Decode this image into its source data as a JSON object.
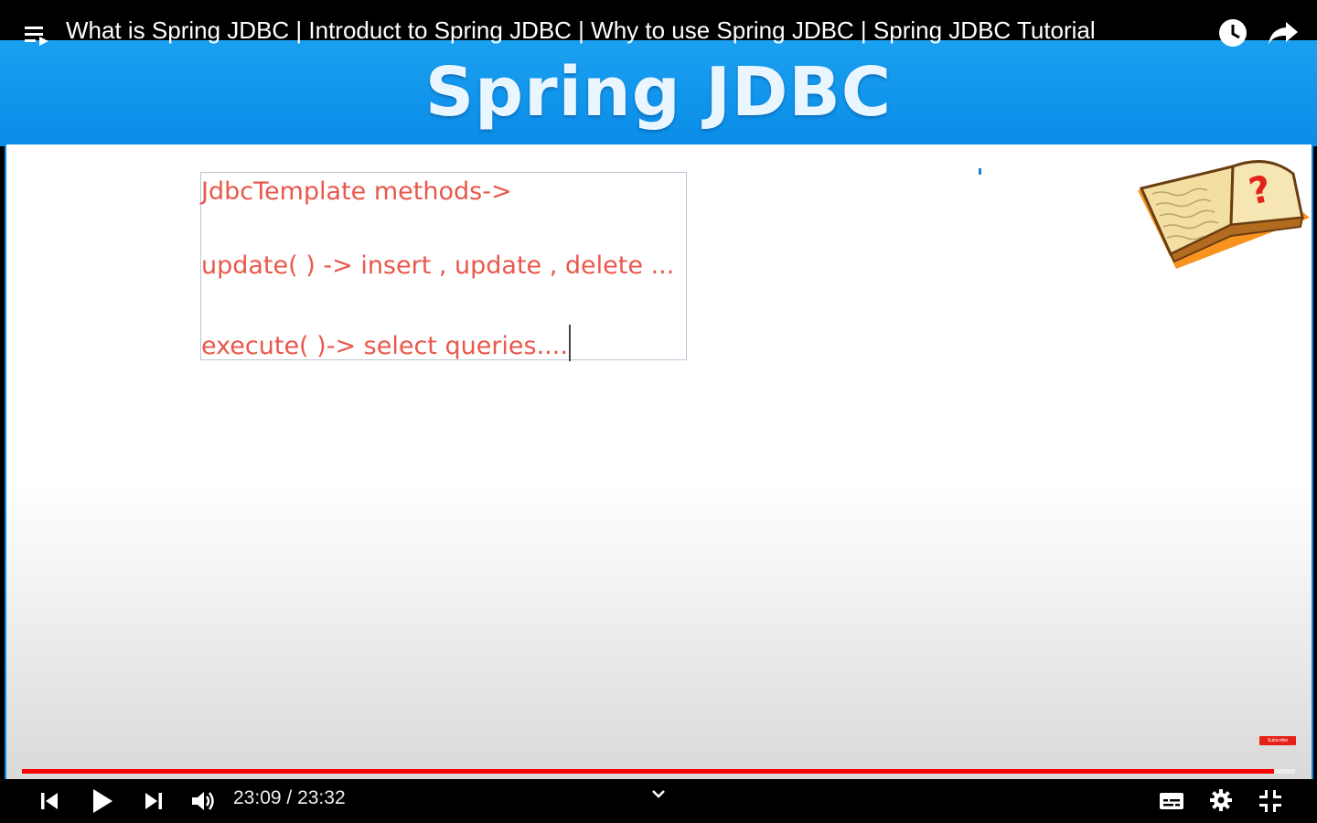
{
  "top_bar": {
    "title": "What is Spring JDBC | Introduct to Spring JDBC | Why to use Spring JDBC | Spring JDBC Tutorial"
  },
  "slide": {
    "heading": "Spring JDBC",
    "lines": [
      "JdbcTemplate methods->",
      "update(  ) -> insert , update , delete ...",
      "execute( )-> select queries...."
    ],
    "subscribe_label": "Subscribe"
  },
  "player": {
    "current_time": "23:09",
    "separator": " / ",
    "duration": "23:32",
    "progress_fraction": 0.9835
  },
  "icons": {
    "playlist": "playlist-icon",
    "watch_later": "clock-icon",
    "share": "share-icon",
    "previous": "previous-icon",
    "play": "play-icon",
    "next": "next-icon",
    "volume": "volume-icon",
    "chevron": "chevron-down-icon",
    "captions": "captions-icon",
    "settings": "gear-icon",
    "exit_fullscreen": "exit-fullscreen-icon"
  },
  "colors": {
    "accent_red": "#ff0000",
    "slide_blue": "#0a8ce8",
    "note_text": "#e8584c"
  }
}
